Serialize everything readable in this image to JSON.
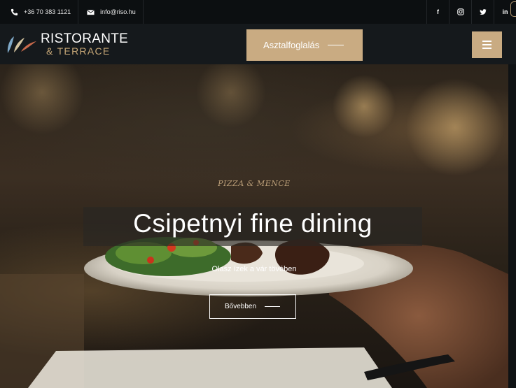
{
  "topbar": {
    "phone": "+36 70 383 1121",
    "email": "info@riso.hu",
    "social": [
      "f",
      "instagram-icon",
      "twitter-icon",
      "in"
    ]
  },
  "header": {
    "logo_line1": "RISTORANTE",
    "logo_line2": "& TERRACE",
    "book_label": "Asztalfoglalás"
  },
  "hero": {
    "kicker": "PIZZA & MENCE",
    "title": "Csipetnyi fine dining",
    "subtitle": "Olasz ízek a vár tövében",
    "cta_label": "Bővebben"
  },
  "colors": {
    "accent": "#c9ab82",
    "topbar_bg": "#0c0f11",
    "header_bg": "#15191c"
  }
}
